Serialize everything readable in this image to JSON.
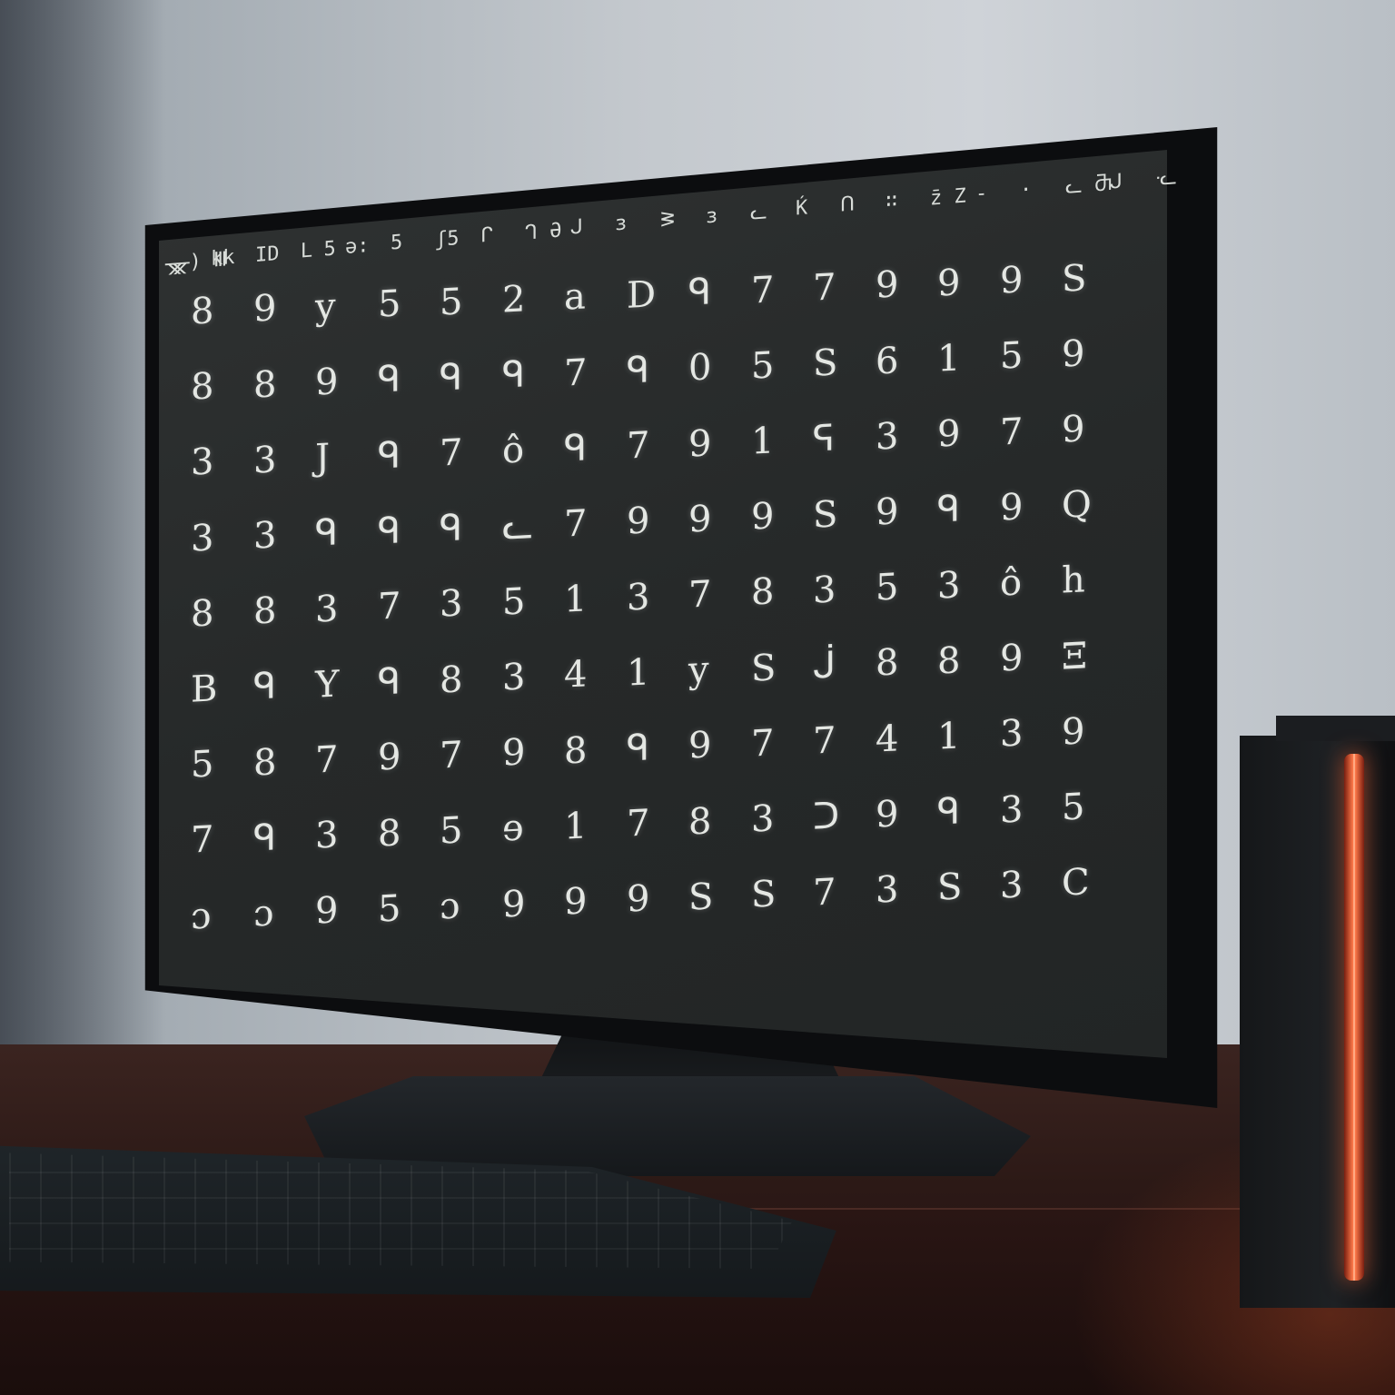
{
  "scene": {
    "colors": {
      "wall": "#c3c8cd",
      "desk": "#2c1916",
      "screen": "#262929",
      "bezel": "#0c0d0f",
      "digits": "#e4e7e3",
      "speaker_led": "#ff7a4a"
    }
  },
  "screen": {
    "header": [
      "ᚘ) Ⅲ",
      "kk",
      "ID",
      "ᒪ 5",
      "ə:",
      "5",
      "ʃ5",
      "ᒋ",
      "ᒉ Ə",
      "ᒍ",
      "ɜ",
      "ᕒ",
      "ɜ",
      "ᓚ",
      "Ḱ",
      "ᑎ",
      "∷",
      "z̄ Z",
      "-",
      "·",
      "ᓚ Ⴋ",
      "ᒍ",
      "ᓦ"
    ],
    "digit_rows": [
      [
        "8",
        "9",
        "y",
        "5",
        "5",
        "2",
        "a",
        "D",
        "ᑫ",
        "7",
        "7",
        "9",
        "9",
        "9",
        "S"
      ],
      [
        "8",
        "8",
        "9",
        "ᑫ",
        "ᑫ",
        "ᑫ",
        "7",
        "ᑫ",
        "0",
        "5",
        "S",
        "6",
        "1",
        "5",
        "9"
      ],
      [
        "3",
        "3",
        "J",
        "ᑫ",
        "7",
        "ô",
        "ᑫ",
        "7",
        "9",
        "1",
        "ᕋ",
        "3",
        "9",
        "7",
        "9"
      ],
      [
        "3",
        "3",
        "ᑫ",
        "ᑫ",
        "ᑫ",
        "ᓚ",
        "7",
        "9",
        "9",
        "9",
        "S",
        "9",
        "ᑫ",
        "9",
        "Q"
      ],
      [
        "8",
        "8",
        "3",
        "7",
        "3",
        "5",
        "1",
        "3",
        "7",
        "8",
        "3",
        "5",
        "3",
        "ô",
        "h"
      ],
      [
        "B",
        "ᑫ",
        "Y",
        "ᑫ",
        "8",
        "3",
        "4",
        "1",
        "y",
        "S",
        "ᒎ",
        "8",
        "8",
        "9",
        "Ξ"
      ],
      [
        "5",
        "8",
        "7",
        "9",
        "7",
        "9",
        "8",
        "ᑫ",
        "9",
        "7",
        "7",
        "4",
        "1",
        "3",
        "9"
      ],
      [
        "7",
        "ᑫ",
        "3",
        "8",
        "5",
        "ɘ",
        "1",
        "7",
        "8",
        "3",
        "ᑐ",
        "9",
        "ᑫ",
        "3",
        "5"
      ],
      [
        "ɔ",
        "ɔ",
        "9",
        "5",
        "ɔ",
        "9",
        "9",
        "9",
        "S",
        "S",
        "7",
        "3",
        "S",
        "3",
        "C"
      ]
    ]
  }
}
